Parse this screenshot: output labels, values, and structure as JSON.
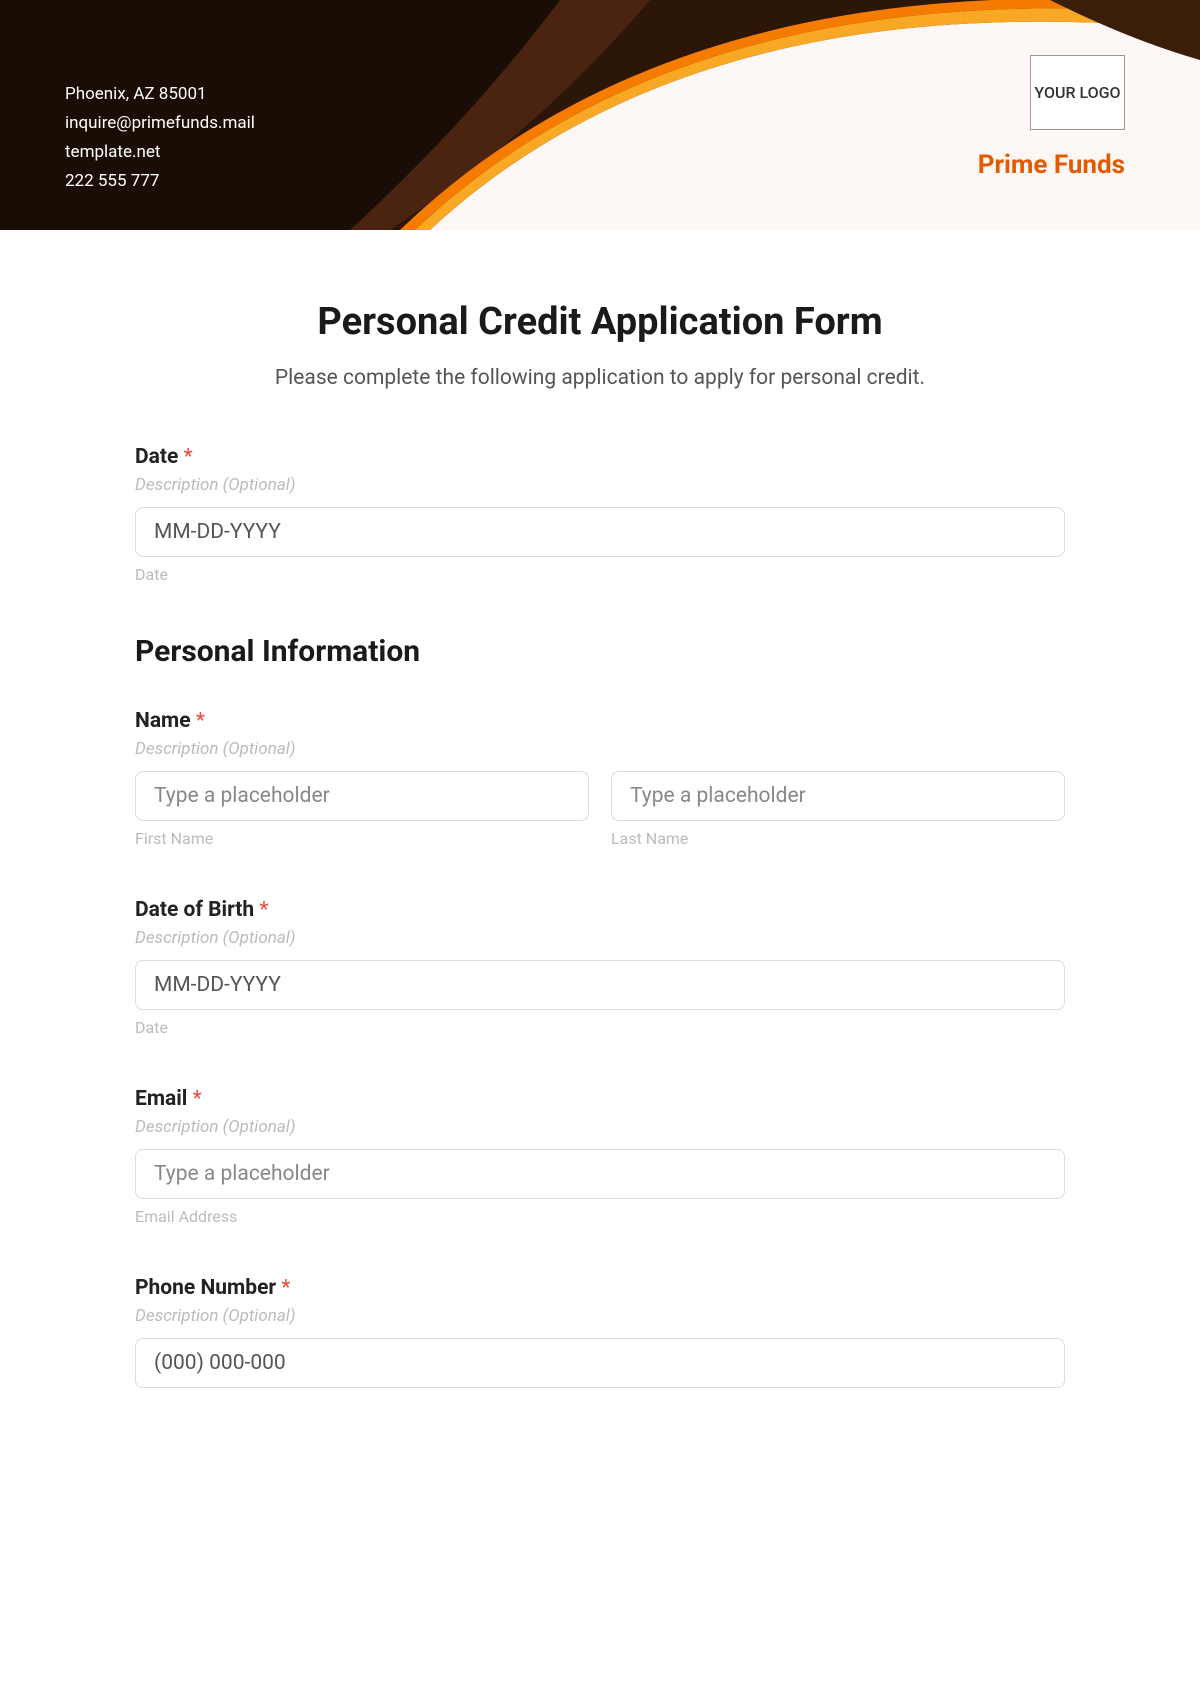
{
  "header": {
    "contact": {
      "line1": "Phoenix, AZ 85001",
      "line2": "inquire@primefunds.mail",
      "line3": "template.net",
      "line4": "222 555 777"
    },
    "logo_text": "YOUR LOGO",
    "brand": "Prime Funds"
  },
  "form": {
    "title": "Personal Credit Application Form",
    "subtitle": "Please complete the following application to apply for personal credit.",
    "desc_placeholder": "Description (Optional)",
    "required_mark": "*",
    "date_field": {
      "label": "Date",
      "placeholder": "MM-DD-YYYY",
      "sublabel": "Date"
    },
    "section_personal": "Personal Information",
    "name_field": {
      "label": "Name",
      "first_placeholder": "Type a placeholder",
      "first_sublabel": "First Name",
      "last_placeholder": "Type a placeholder",
      "last_sublabel": "Last Name"
    },
    "dob_field": {
      "label": "Date of Birth",
      "placeholder": "MM-DD-YYYY",
      "sublabel": "Date"
    },
    "email_field": {
      "label": "Email",
      "placeholder": "Type a placeholder",
      "sublabel": "Email Address"
    },
    "phone_field": {
      "label": "Phone Number",
      "placeholder": "(000) 000-000"
    }
  }
}
